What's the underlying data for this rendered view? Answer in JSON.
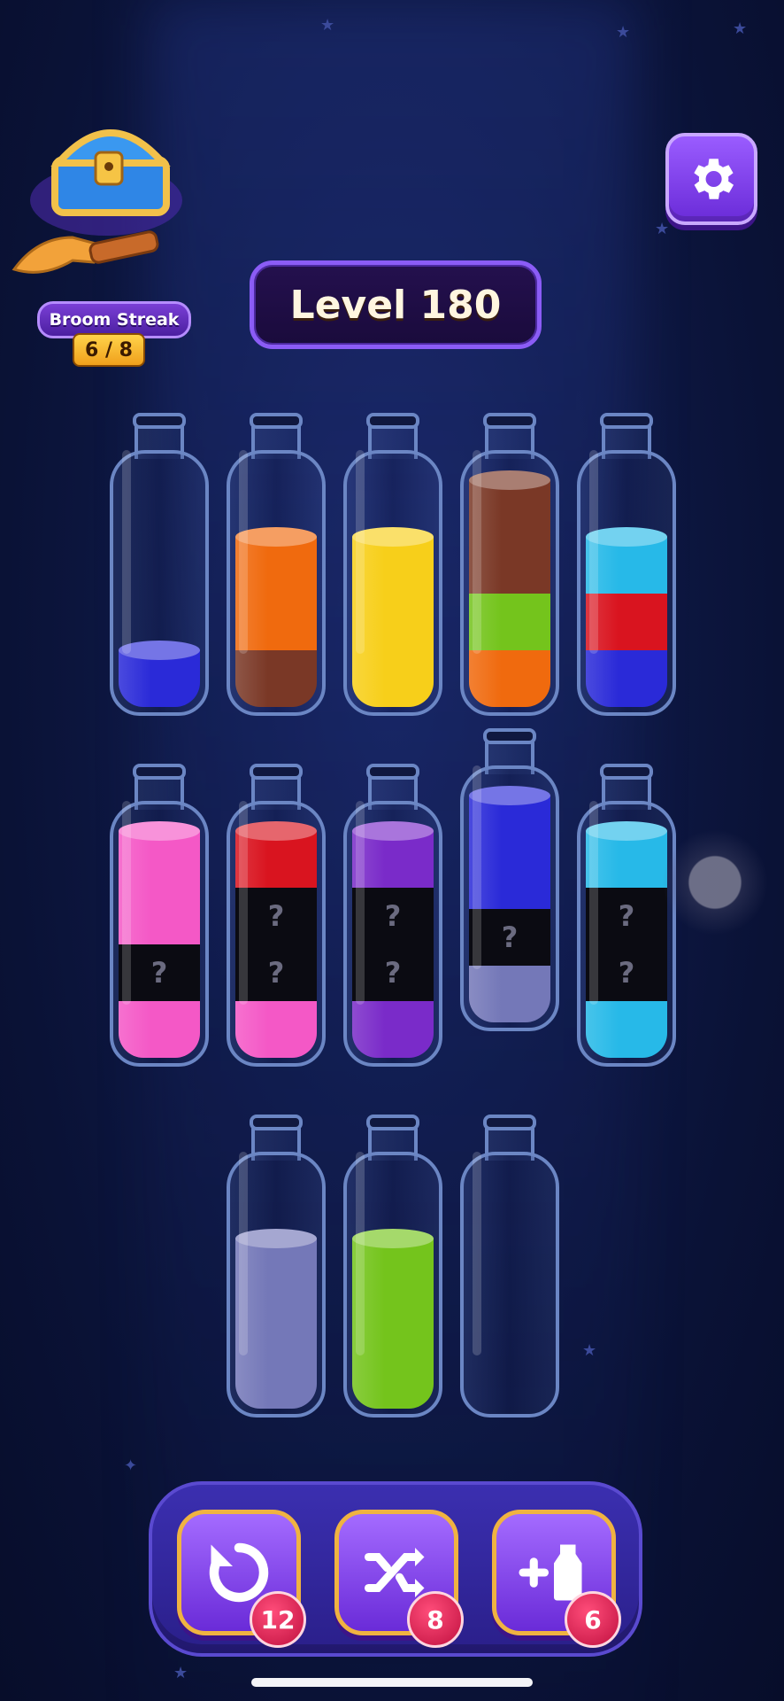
{
  "streak": {
    "label": "Broom Streak",
    "count": "6 / 8"
  },
  "level": {
    "label": "Level 180"
  },
  "colors": {
    "blue": "#2a2ad8",
    "orange": "#f06a0e",
    "brown": "#7a3826",
    "yellow": "#f7cf1a",
    "green": "#74c41c",
    "cyan": "#27b9e8",
    "red": "#d9141f",
    "pink": "#f458c6",
    "purple": "#7a2bc9",
    "lavender": "#7478b8"
  },
  "bottles_row1": [
    {
      "segments": [
        {
          "color": "blue",
          "units": 1
        }
      ]
    },
    {
      "segments": [
        {
          "color": "brown",
          "units": 1
        },
        {
          "color": "orange",
          "units": 2
        }
      ]
    },
    {
      "segments": [
        {
          "color": "yellow",
          "units": 3
        }
      ]
    },
    {
      "segments": [
        {
          "color": "orange",
          "units": 1
        },
        {
          "color": "green",
          "units": 1
        },
        {
          "color": "brown",
          "units": 2
        }
      ]
    },
    {
      "segments": [
        {
          "color": "blue",
          "units": 1
        },
        {
          "color": "red",
          "units": 1
        },
        {
          "color": "cyan",
          "units": 1
        }
      ]
    }
  ],
  "bottles_row2": [
    {
      "segments": [
        {
          "color": "pink",
          "units": 1
        },
        {
          "color": "hidden",
          "units": 1
        },
        {
          "color": "pink",
          "units": 2
        }
      ]
    },
    {
      "segments": [
        {
          "color": "pink",
          "units": 1
        },
        {
          "color": "hidden",
          "units": 1
        },
        {
          "color": "hidden",
          "units": 1
        },
        {
          "color": "red",
          "units": 1
        }
      ]
    },
    {
      "segments": [
        {
          "color": "purple",
          "units": 1
        },
        {
          "color": "hidden",
          "units": 1
        },
        {
          "color": "hidden",
          "units": 1
        },
        {
          "color": "purple",
          "units": 1
        }
      ]
    },
    {
      "segments": [
        {
          "color": "lavender",
          "units": 1
        },
        {
          "color": "hidden",
          "units": 1
        },
        {
          "color": "blue",
          "units": 2
        }
      ],
      "lifted": true
    },
    {
      "segments": [
        {
          "color": "cyan",
          "units": 1
        },
        {
          "color": "hidden",
          "units": 1
        },
        {
          "color": "hidden",
          "units": 1
        },
        {
          "color": "cyan",
          "units": 1
        }
      ]
    }
  ],
  "bottles_row3": [
    {
      "segments": [
        {
          "color": "lavender",
          "units": 3
        }
      ]
    },
    {
      "segments": [
        {
          "color": "green",
          "units": 3
        }
      ]
    },
    {
      "segments": []
    }
  ],
  "powerups": {
    "undo": {
      "icon": "undo-icon",
      "count": "12"
    },
    "shuffle": {
      "icon": "shuffle-icon",
      "count": "8"
    },
    "add_bottle": {
      "icon": "add-bottle-icon",
      "count": "6"
    }
  }
}
